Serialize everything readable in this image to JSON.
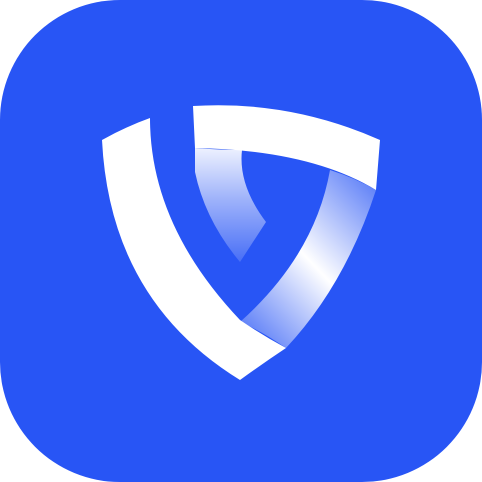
{
  "app_icon": {
    "icon": "shield-logo-icon",
    "colors": {
      "tile_background": "#2855F5",
      "glyph": "#FFFFFF",
      "glyph_shade": "#A9B8F6"
    }
  }
}
